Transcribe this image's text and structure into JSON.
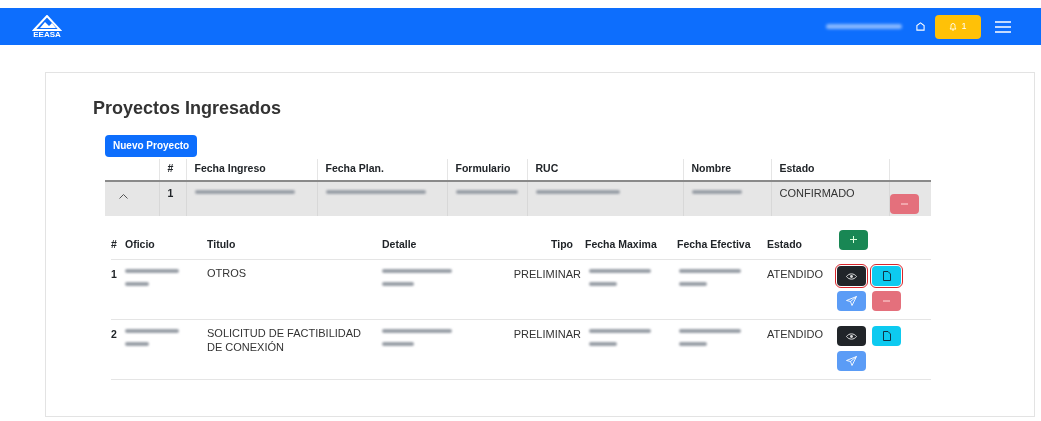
{
  "navbar": {
    "logo_text": "EEASA",
    "notification_count": "1"
  },
  "page": {
    "title": "Proyectos Ingresados",
    "new_button": "Nuevo Proyecto"
  },
  "projects_table": {
    "columns": [
      "#",
      "Fecha Ingreso",
      "Fecha Plan.",
      "Formulario",
      "RUC",
      "Nombre",
      "Estado"
    ],
    "rows": [
      {
        "expanded": true,
        "number": "1",
        "estado": "CONFIRMADO",
        "details": {
          "columns": [
            "#",
            "Oficio",
            "Titulo",
            "Detalle",
            "Tipo",
            "Fecha Maxima",
            "Fecha Efectiva",
            "Estado"
          ],
          "rows": [
            {
              "number": "1",
              "titulo": "OTROS",
              "tipo": "PRELIMINAR",
              "estado": "ATENDIDO",
              "actions": [
                {
                  "kind": "view",
                  "highlighted": true
                },
                {
                  "kind": "file",
                  "highlighted": true
                },
                {
                  "kind": "send",
                  "highlighted": false
                },
                {
                  "kind": "delete",
                  "highlighted": false
                }
              ]
            },
            {
              "number": "2",
              "titulo": "SOLICITUD DE FACTIBILIDAD DE CONEXIÓN",
              "tipo": "PRELIMINAR",
              "estado": "ATENDIDO",
              "actions": [
                {
                  "kind": "view",
                  "highlighted": false
                },
                {
                  "kind": "file",
                  "highlighted": false
                },
                {
                  "kind": "send",
                  "highlighted": false
                }
              ]
            }
          ]
        }
      }
    ]
  }
}
